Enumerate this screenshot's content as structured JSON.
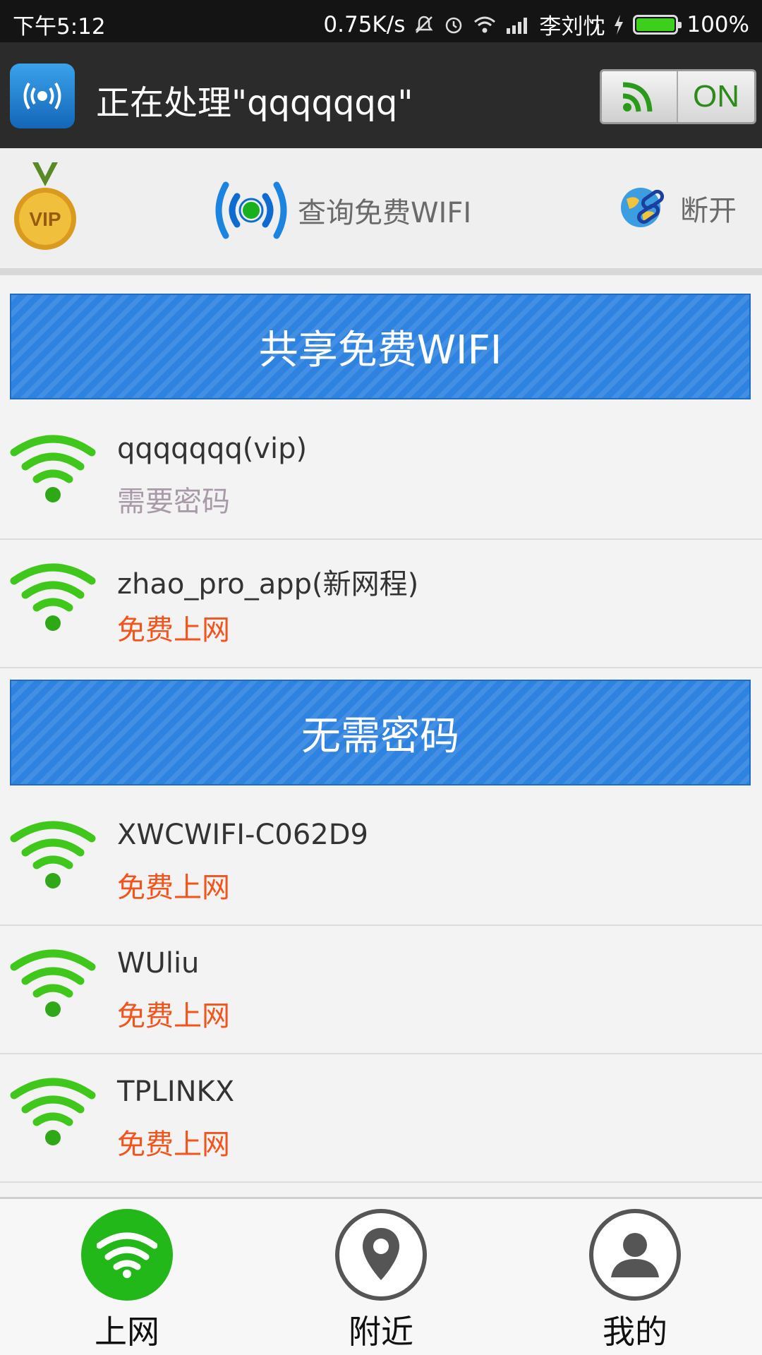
{
  "status_bar": {
    "time": "下午5:12",
    "speed": "0.75K/s",
    "carrier": "李刘忱",
    "battery": "100%"
  },
  "title_bar": {
    "title": "正在处理\"qqqqqqq\"",
    "toggle_state": "ON"
  },
  "action_bar": {
    "vip_label": "VIP",
    "query_label": "查询免费WIFI",
    "disconnect_label": "断开"
  },
  "sections": [
    {
      "title": "共享免费WIFI",
      "items": [
        {
          "name": "qqqqqqq(vip)",
          "status": "需要密码",
          "status_type": "gray"
        },
        {
          "name": "zhao_pro_app(新网程)",
          "status": "免费上网",
          "status_type": "orange"
        }
      ]
    },
    {
      "title": "无需密码",
      "items": [
        {
          "name": "XWCWIFI-C062D9",
          "status": "免费上网",
          "status_type": "orange"
        },
        {
          "name": "WUliu",
          "status": "免费上网",
          "status_type": "orange"
        },
        {
          "name": "TPLINKX",
          "status": "免费上网",
          "status_type": "orange"
        }
      ]
    }
  ],
  "bottom_nav": [
    {
      "label": "上网",
      "icon": "wifi-icon",
      "active": true
    },
    {
      "label": "附近",
      "icon": "location-pin-icon",
      "active": false
    },
    {
      "label": "我的",
      "icon": "user-icon",
      "active": false
    }
  ],
  "colors": {
    "accent_blue": "#2e82e0",
    "wifi_green": "#3fc81b",
    "free_orange": "#f2541b",
    "password_gray": "#a99aa9"
  }
}
